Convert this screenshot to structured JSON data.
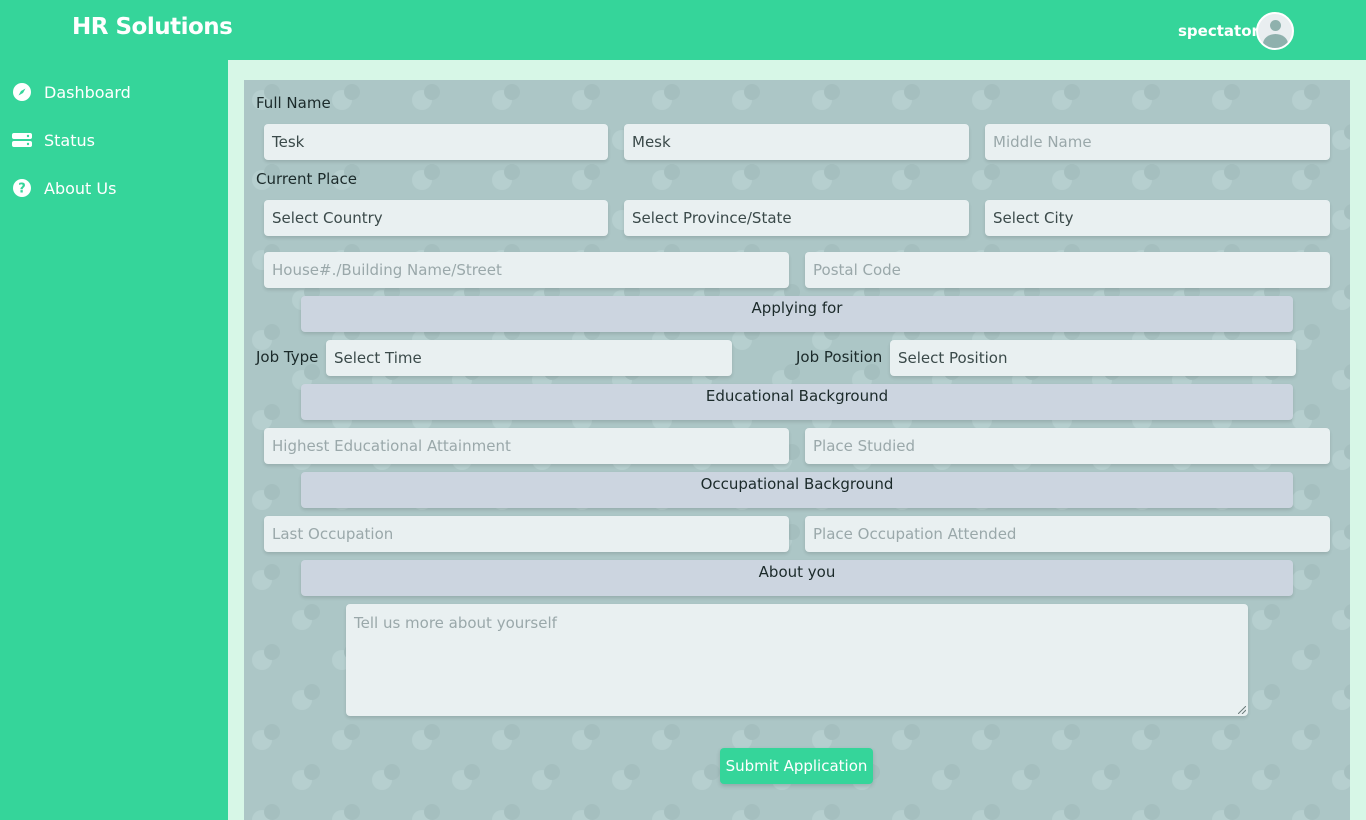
{
  "header": {
    "brand": "HR Solutions",
    "username": "spectator",
    "avatar_icon": "user-avatar-icon"
  },
  "sidebar": {
    "items": [
      {
        "label": "Dashboard",
        "icon": "compass-icon"
      },
      {
        "label": "Status",
        "icon": "server-icon"
      },
      {
        "label": "About Us",
        "icon": "question-icon"
      }
    ]
  },
  "form": {
    "full_name_label": "Full Name",
    "first_name": "Tesk",
    "last_name": "Mesk",
    "middle_name_placeholder": "Middle Name",
    "current_place_label": "Current Place",
    "country": "Select Country",
    "province": "Select Province/State",
    "city": "Select City",
    "street_placeholder": "House#./Building Name/Street",
    "postal_placeholder": "Postal Code",
    "applying_for": "Applying for",
    "job_type_label": "Job Type",
    "job_type_value": "Select Time",
    "job_position_label": "Job Position",
    "job_position_value": "Select Position",
    "educational_background": "Educational Background",
    "education_placeholder": "Highest Educational Attainment",
    "place_studied_placeholder": "Place Studied",
    "occupational_background": "Occupational Background",
    "last_occupation_placeholder": "Last Occupation",
    "place_occupation_placeholder": "Place Occupation Attended",
    "about_you": "About you",
    "about_placeholder": "Tell us more about yourself",
    "submit_label": "Submit Application"
  },
  "colors": {
    "accent": "#35d59a",
    "panel": "#acc6c6",
    "section": "#ccd5e0",
    "field": "#e9f0f1"
  }
}
